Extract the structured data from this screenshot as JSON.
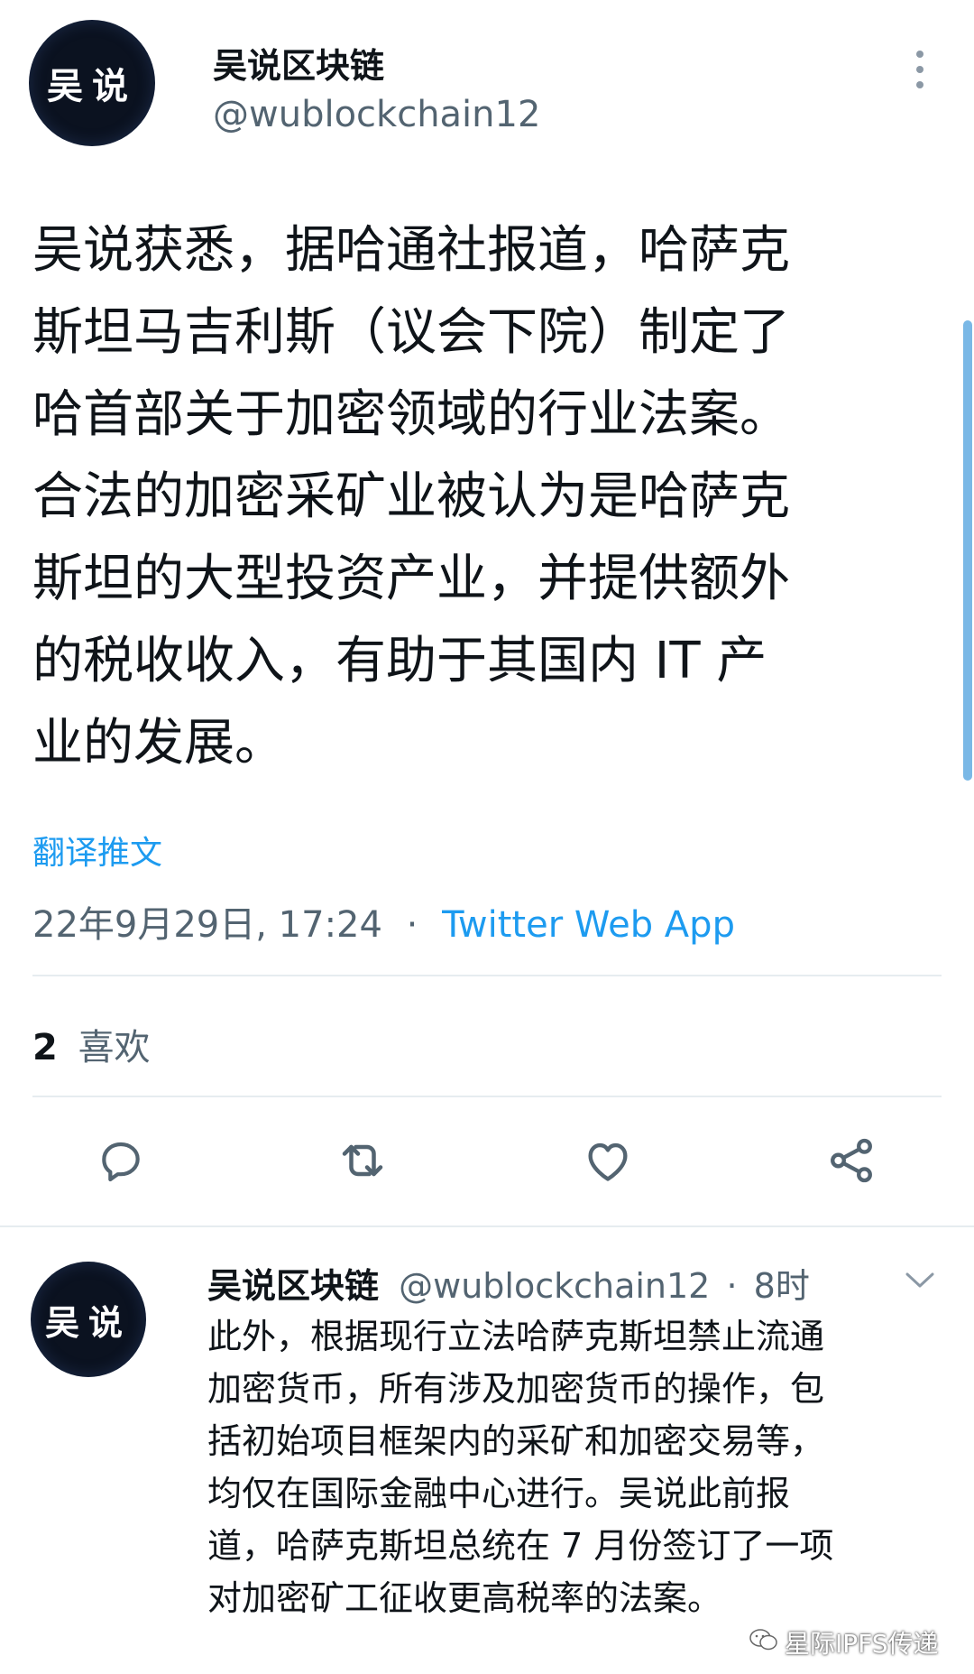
{
  "main_tweet": {
    "avatar_text": "吴说",
    "author_name": "吴说区块链",
    "author_handle": "@wublockchain12",
    "body_lines": [
      "吴说获悉，据哈通社报道，哈萨克",
      "斯坦马吉利斯（议会下院）制定了",
      "哈首部关于加密领域的行业法案。",
      "合法的加密采矿业被认为是哈萨克",
      "斯坦的大型投资产业，并提供额外",
      "的税收收入，有助于其国内 IT 产",
      "业的发展。"
    ],
    "translate_label": "翻译推文",
    "timestamp": "22年9月29日, 17:24",
    "separator": "·",
    "source": "Twitter Web App",
    "likes_count": "2",
    "likes_label": "喜欢"
  },
  "actions": {
    "reply_icon": "reply-icon",
    "retweet_icon": "retweet-icon",
    "like_icon": "like-icon",
    "share_icon": "share-icon"
  },
  "reply_tweet": {
    "avatar_text": "吴说",
    "author_name": "吴说区块链",
    "author_handle": "@wublockchain12",
    "separator": "·",
    "time": "8时",
    "body_lines": [
      "此外，根据现行立法哈萨克斯坦禁止流通",
      "加密货币，所有涉及加密货币的操作，包",
      "括初始项目框架内的采矿和加密交易等，",
      "均仅在国际金融中心进行。吴说此前报",
      "道，哈萨克斯坦总统在 7 月份签订了一项",
      "对加密矿工征收更高税率的法案。"
    ]
  },
  "watermark": {
    "text": "星际IPFS传递"
  },
  "colors": {
    "accent": "#1d9bf0",
    "text": "#0f1419",
    "secondary": "#536471",
    "divider": "#e6ecf0"
  }
}
